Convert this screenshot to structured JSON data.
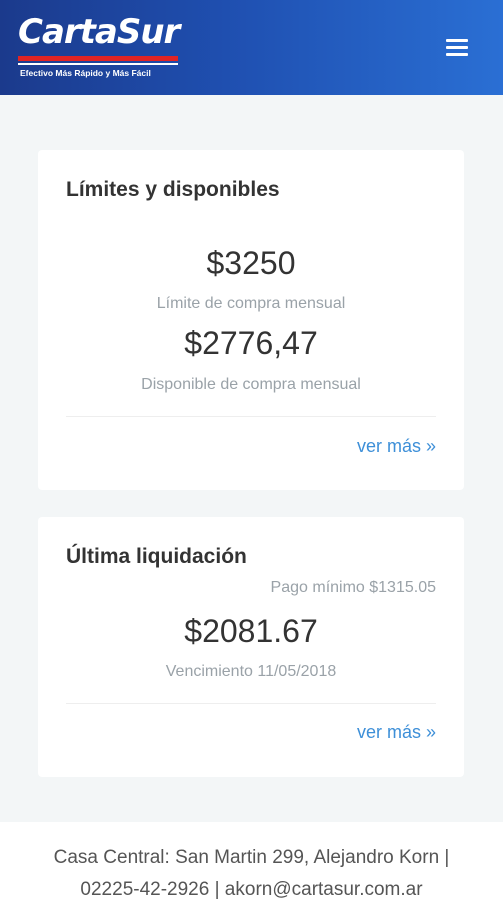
{
  "header": {
    "logo_text": "CartaSur",
    "tagline": "Efectivo Más Rápido y Más Fácil",
    "menu_icon": "hamburger-menu-icon",
    "colors": {
      "gradient_start": "#1b3a8c",
      "gradient_end": "#2a6fd4",
      "logo_stripe": "#e02424"
    }
  },
  "limits_card": {
    "title": "Límites y disponibles",
    "limit_amount": "$3250",
    "limit_label": "Límite de compra mensual",
    "available_amount": "$2776,47",
    "available_label": "Disponible de compra mensual",
    "more_link": "ver más »"
  },
  "settlement_card": {
    "title": "Última liquidación",
    "minimum_payment": "Pago mínimo $1315.05",
    "amount": "$2081.67",
    "due_date": "Vencimiento 11/05/2018",
    "more_link": "ver más »"
  },
  "footer": {
    "address_line": "Casa Central: San Martin 299, Alejandro Korn |",
    "contact_line": "02225-42-2926 | akorn@cartasur.com.ar"
  },
  "colors": {
    "link": "#3d8fd8",
    "muted": "#9aa2a8",
    "background": "#f3f6f7"
  }
}
